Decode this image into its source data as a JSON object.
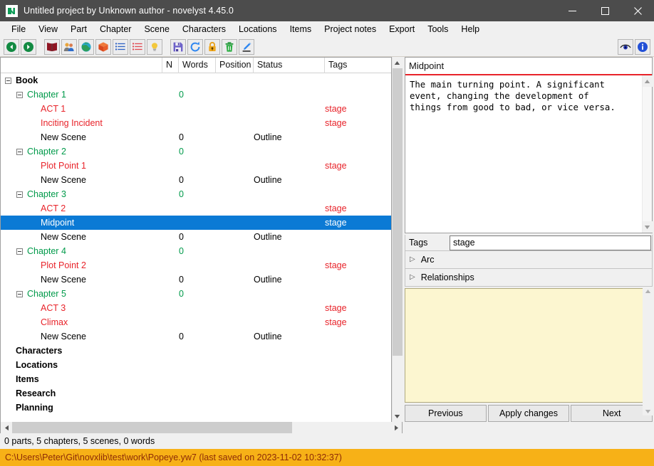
{
  "window": {
    "title": "Untitled project by Unknown author - novelyst 4.45.0",
    "app_icon": "novelyst-n-icon",
    "minimize": "minimize-icon",
    "maximize": "maximize-icon",
    "close": "close-icon"
  },
  "menubar": {
    "items": [
      {
        "label": "File"
      },
      {
        "label": "View"
      },
      {
        "label": "Part"
      },
      {
        "label": "Chapter"
      },
      {
        "label": "Scene"
      },
      {
        "label": "Characters"
      },
      {
        "label": "Locations"
      },
      {
        "label": "Items"
      },
      {
        "label": "Project notes"
      },
      {
        "label": "Export"
      },
      {
        "label": "Tools"
      },
      {
        "label": "Help"
      }
    ]
  },
  "toolbar": {
    "groups": [
      [
        "go-back-icon",
        "go-forward-icon"
      ],
      [
        "book-icon",
        "characters-icon",
        "locations-globe-icon",
        "items-box-icon",
        "project-notes-list-icon",
        "export-list-icon",
        "lightbulb-icon"
      ],
      [
        "save-icon",
        "reload-icon",
        "lock-icon",
        "delete-trash-icon",
        "edit-pencil-icon"
      ]
    ],
    "right": [
      "eye-icon",
      "info-icon"
    ]
  },
  "tree": {
    "columns": [
      {
        "key": "name",
        "label": ""
      },
      {
        "key": "n",
        "label": "N"
      },
      {
        "key": "words",
        "label": "Words"
      },
      {
        "key": "position",
        "label": "Position"
      },
      {
        "key": "status",
        "label": "Status"
      },
      {
        "key": "tags",
        "label": "Tags"
      }
    ],
    "rows": [
      {
        "name": "Book",
        "level": 0,
        "expander": "minus",
        "color": "black",
        "bold": true,
        "n": "",
        "words": "",
        "position": "",
        "status": "",
        "tags": "",
        "selected": false
      },
      {
        "name": "Chapter 1",
        "level": 1,
        "expander": "minus",
        "color": "green",
        "bold": false,
        "n": "",
        "words": "0",
        "position": "",
        "status": "",
        "tags": "",
        "selected": false
      },
      {
        "name": "ACT 1",
        "level": 2,
        "expander": "none",
        "color": "red",
        "bold": false,
        "n": "",
        "words": "",
        "position": "",
        "status": "",
        "tags": "stage",
        "selected": false
      },
      {
        "name": "Inciting Incident",
        "level": 2,
        "expander": "none",
        "color": "red",
        "bold": false,
        "n": "",
        "words": "",
        "position": "",
        "status": "",
        "tags": "stage",
        "selected": false
      },
      {
        "name": "New Scene",
        "level": 2,
        "expander": "none",
        "color": "black",
        "bold": false,
        "n": "",
        "words": "0",
        "position": "",
        "status": "Outline",
        "tags": "",
        "selected": false
      },
      {
        "name": "Chapter 2",
        "level": 1,
        "expander": "minus",
        "color": "green",
        "bold": false,
        "n": "",
        "words": "0",
        "position": "",
        "status": "",
        "tags": "",
        "selected": false
      },
      {
        "name": "Plot Point 1",
        "level": 2,
        "expander": "none",
        "color": "red",
        "bold": false,
        "n": "",
        "words": "",
        "position": "",
        "status": "",
        "tags": "stage",
        "selected": false
      },
      {
        "name": "New Scene",
        "level": 2,
        "expander": "none",
        "color": "black",
        "bold": false,
        "n": "",
        "words": "0",
        "position": "",
        "status": "Outline",
        "tags": "",
        "selected": false
      },
      {
        "name": "Chapter 3",
        "level": 1,
        "expander": "minus",
        "color": "green",
        "bold": false,
        "n": "",
        "words": "0",
        "position": "",
        "status": "",
        "tags": "",
        "selected": false
      },
      {
        "name": "ACT 2",
        "level": 2,
        "expander": "none",
        "color": "red",
        "bold": false,
        "n": "",
        "words": "",
        "position": "",
        "status": "",
        "tags": "stage",
        "selected": false
      },
      {
        "name": "Midpoint",
        "level": 2,
        "expander": "none",
        "color": "white",
        "bold": false,
        "n": "",
        "words": "",
        "position": "",
        "status": "",
        "tags": "stage",
        "selected": true
      },
      {
        "name": "New Scene",
        "level": 2,
        "expander": "none",
        "color": "black",
        "bold": false,
        "n": "",
        "words": "0",
        "position": "",
        "status": "Outline",
        "tags": "",
        "selected": false
      },
      {
        "name": "Chapter 4",
        "level": 1,
        "expander": "minus",
        "color": "green",
        "bold": false,
        "n": "",
        "words": "0",
        "position": "",
        "status": "",
        "tags": "",
        "selected": false
      },
      {
        "name": "Plot Point 2",
        "level": 2,
        "expander": "none",
        "color": "red",
        "bold": false,
        "n": "",
        "words": "",
        "position": "",
        "status": "",
        "tags": "stage",
        "selected": false
      },
      {
        "name": "New Scene",
        "level": 2,
        "expander": "none",
        "color": "black",
        "bold": false,
        "n": "",
        "words": "0",
        "position": "",
        "status": "Outline",
        "tags": "",
        "selected": false
      },
      {
        "name": "Chapter 5",
        "level": 1,
        "expander": "minus",
        "color": "green",
        "bold": false,
        "n": "",
        "words": "0",
        "position": "",
        "status": "",
        "tags": "",
        "selected": false
      },
      {
        "name": "ACT 3",
        "level": 2,
        "expander": "none",
        "color": "red",
        "bold": false,
        "n": "",
        "words": "",
        "position": "",
        "status": "",
        "tags": "stage",
        "selected": false
      },
      {
        "name": "Climax",
        "level": 2,
        "expander": "none",
        "color": "red",
        "bold": false,
        "n": "",
        "words": "",
        "position": "",
        "status": "",
        "tags": "stage",
        "selected": false
      },
      {
        "name": "New Scene",
        "level": 2,
        "expander": "none",
        "color": "black",
        "bold": false,
        "n": "",
        "words": "0",
        "position": "",
        "status": "Outline",
        "tags": "",
        "selected": false
      },
      {
        "name": "Characters",
        "level": 0,
        "expander": "none",
        "color": "black",
        "bold": true,
        "n": "",
        "words": "",
        "position": "",
        "status": "",
        "tags": "",
        "selected": false
      },
      {
        "name": "Locations",
        "level": 0,
        "expander": "none",
        "color": "black",
        "bold": true,
        "n": "",
        "words": "",
        "position": "",
        "status": "",
        "tags": "",
        "selected": false
      },
      {
        "name": "Items",
        "level": 0,
        "expander": "none",
        "color": "black",
        "bold": true,
        "n": "",
        "words": "",
        "position": "",
        "status": "",
        "tags": "",
        "selected": false
      },
      {
        "name": "Research",
        "level": 0,
        "expander": "none",
        "color": "black",
        "bold": true,
        "n": "",
        "words": "",
        "position": "",
        "status": "",
        "tags": "",
        "selected": false
      },
      {
        "name": "Planning",
        "level": 0,
        "expander": "none",
        "color": "black",
        "bold": true,
        "n": "",
        "words": "",
        "position": "",
        "status": "",
        "tags": "",
        "selected": false
      }
    ]
  },
  "inspector": {
    "title_value": "Midpoint",
    "description": "The main turning point. A significant\nevent, changing the development of\nthings from good to bad, or vice versa.",
    "tags_label": "Tags",
    "tags_value": "stage",
    "sections": [
      {
        "label": "Arc",
        "expanded": false
      },
      {
        "label": "Relationships",
        "expanded": false
      }
    ],
    "notes_value": "",
    "buttons": [
      {
        "label": "Previous"
      },
      {
        "label": "Apply changes"
      },
      {
        "label": "Next"
      }
    ]
  },
  "status": {
    "summary": "0 parts, 5 chapters, 5 scenes, 0 words",
    "path": "C:\\Users\\Peter\\Git\\novxlib\\test\\work\\Popeye.yw7 (last saved on 2023-11-02 10:32:37)"
  },
  "colors": {
    "titlebar": "#4c4c4c",
    "selection": "#0b7ad5",
    "chapter_green": "#009a4a",
    "stage_red": "#e8232a",
    "path_bar_bg": "#f7b117",
    "path_bar_fg": "#8d2a06",
    "notes_bg": "#fcf6d0",
    "red_rule": "#e8232a"
  }
}
